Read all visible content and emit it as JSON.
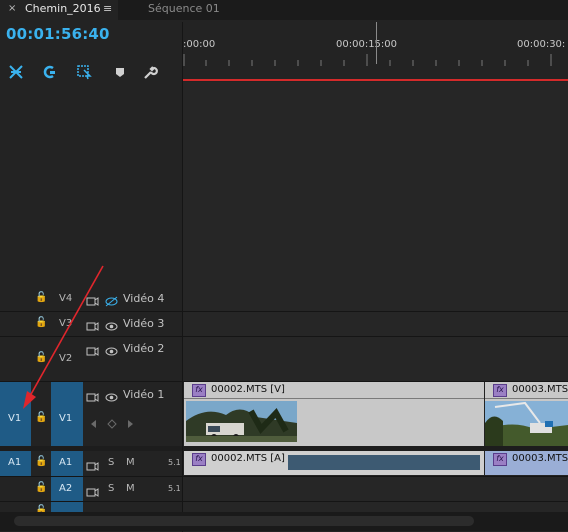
{
  "tabs": {
    "active": {
      "close": "×",
      "label": "Chemin_2016",
      "menu": "≡"
    },
    "sequence": {
      "label": "Séquence 01"
    }
  },
  "timecode": "00:01:56:40",
  "ruler": {
    "labels": [
      ":00:00",
      "00:00:15:00",
      "00:00:30:"
    ]
  },
  "tools": [
    "snap-icon",
    "linked-selection-icon",
    "add-marker-icon",
    "marker-icon",
    "wrench-icon"
  ],
  "tracks": {
    "v4": {
      "target": "V4",
      "name": "Vidéo 4",
      "eye_hidden": true
    },
    "v3": {
      "target": "V3",
      "name": "Vidéo 3"
    },
    "v2": {
      "target": "V2",
      "name": "Vidéo 2"
    },
    "v1": {
      "source": "V1",
      "target": "V1",
      "name": "Vidéo 1"
    },
    "a1": {
      "source": "A1",
      "target": "A1",
      "solo": "S",
      "mute": "M",
      "channel": "5.1"
    },
    "a2": {
      "target": "A2",
      "solo": "S",
      "mute": "M",
      "channel": "5.1"
    }
  },
  "clips": {
    "v1a": {
      "label": "00002.MTS [V]"
    },
    "v1b": {
      "label": "00003.MTS"
    },
    "a1a": {
      "label": "00002.MTS [A]"
    },
    "a1b": {
      "label": "00003.MTS"
    }
  },
  "colors": {
    "accent": "#3ab2ee",
    "track_target": "#1f5b86",
    "playhead_bar": "#d42a2a",
    "fx_badge": "#9a7fc4",
    "annotation_arrow": "#e0262c"
  }
}
